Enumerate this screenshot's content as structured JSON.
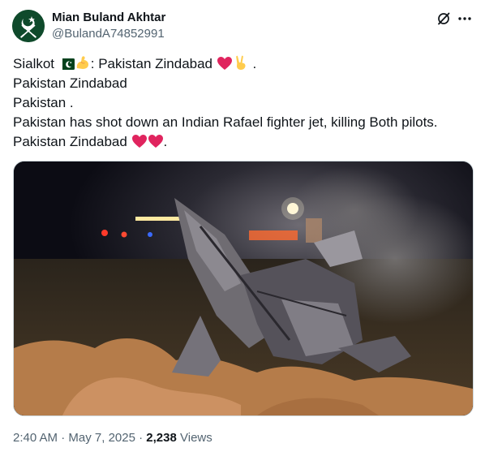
{
  "author": {
    "name": "Mian Buland Akhtar",
    "handle": "@BulandA74852991",
    "avatar_icon": "pakistan-army-emblem-icon"
  },
  "header_actions": {
    "grok_icon": "grok-icon",
    "more_icon": "more-options-icon"
  },
  "tweet": {
    "line1": {
      "text_a": "Sialkot ",
      "emoji_flag": "pakistan-flag-emoji",
      "emoji_flex": "flexed-biceps-emoji",
      "text_b": ": Pakistan Zindabad ",
      "emoji_heart": "red-heart-emoji",
      "emoji_victory": "victory-hand-emoji",
      "text_c": " ."
    },
    "line2": "Pakistan Zindabad",
    "line3": "Pakistan .",
    "line4": "Pakistan has shot down an Indian Rafael fighter jet, killing Both pilots.",
    "line5": {
      "text_a": "Pakistan Zindabad ",
      "emoji_heart_1": "red-heart-emoji",
      "emoji_heart_2": "red-heart-emoji",
      "text_b": "."
    }
  },
  "media": {
    "description_icon": "photo-night-crash-wreckage"
  },
  "meta": {
    "time": "2:40 AM",
    "sep1": " · ",
    "date": "May 7, 2025",
    "sep2": " · ",
    "views_count": "2,238",
    "views_label": " Views"
  },
  "colors": {
    "text": "#0f1419",
    "secondary": "#536471",
    "heart": "#e0245e",
    "avatar_bg": "#0f4a2b"
  }
}
